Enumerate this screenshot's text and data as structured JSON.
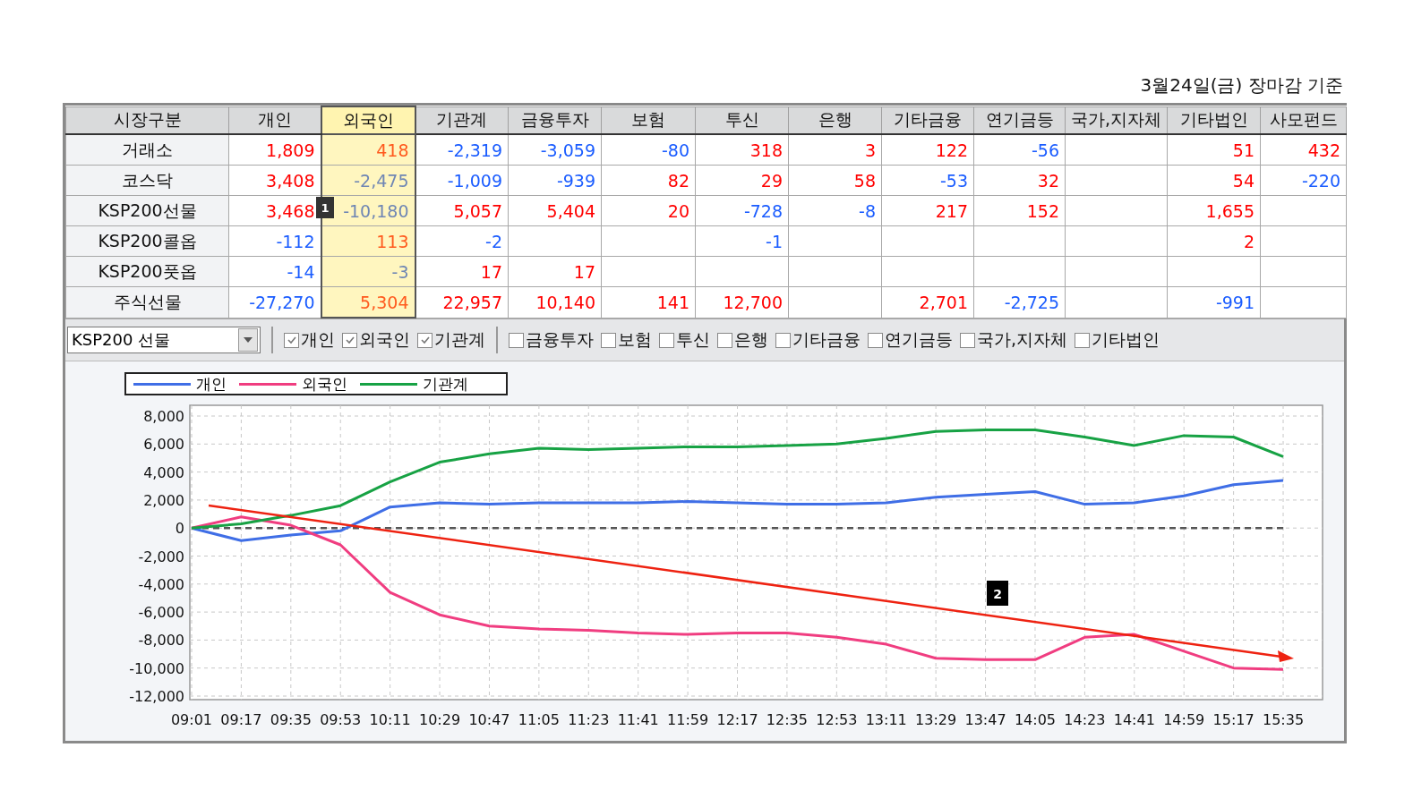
{
  "caption": "3월24일(금) 장마감 기준",
  "table": {
    "marker": "1",
    "columns": [
      {
        "label": "시장구분",
        "highlighted": false
      },
      {
        "label": "개인",
        "highlighted": false
      },
      {
        "label": "외국인",
        "highlighted": true
      },
      {
        "label": "기관계",
        "highlighted": false
      },
      {
        "label": "금융투자",
        "highlighted": false
      },
      {
        "label": "보험",
        "highlighted": false
      },
      {
        "label": "투신",
        "highlighted": false
      },
      {
        "label": "은행",
        "highlighted": false
      },
      {
        "label": "기타금융",
        "highlighted": false
      },
      {
        "label": "연기금등",
        "highlighted": false
      },
      {
        "label": "국가,지자체",
        "highlighted": false
      },
      {
        "label": "기타법인",
        "highlighted": false
      },
      {
        "label": "사모펀드",
        "highlighted": false
      }
    ],
    "rows": [
      {
        "cells": [
          {
            "text": "거래소"
          },
          {
            "text": "1,809",
            "color": "#ff0000"
          },
          {
            "text": "418",
            "color": "#ff5a1e"
          },
          {
            "text": "-2,319",
            "color": "#1a5cff"
          },
          {
            "text": "-3,059",
            "color": "#1a5cff"
          },
          {
            "text": "-80",
            "color": "#1a5cff"
          },
          {
            "text": "318",
            "color": "#ff0000"
          },
          {
            "text": "3",
            "color": "#ff0000"
          },
          {
            "text": "122",
            "color": "#ff0000"
          },
          {
            "text": "-56",
            "color": "#1a5cff"
          },
          null,
          {
            "text": "51",
            "color": "#ff0000"
          },
          {
            "text": "432",
            "color": "#ff0000"
          }
        ]
      },
      {
        "cells": [
          {
            "text": "코스닥"
          },
          {
            "text": "3,408",
            "color": "#ff0000"
          },
          {
            "text": "-2,475",
            "color": "#6f86b4"
          },
          {
            "text": "-1,009",
            "color": "#1a5cff"
          },
          {
            "text": "-939",
            "color": "#1a5cff"
          },
          {
            "text": "82",
            "color": "#ff0000"
          },
          {
            "text": "29",
            "color": "#ff0000"
          },
          {
            "text": "58",
            "color": "#ff0000"
          },
          {
            "text": "-53",
            "color": "#1a5cff"
          },
          {
            "text": "32",
            "color": "#ff0000"
          },
          null,
          {
            "text": "54",
            "color": "#ff0000"
          },
          {
            "text": "-220",
            "color": "#1a5cff"
          }
        ]
      },
      {
        "cells": [
          {
            "text": "KSP200선물"
          },
          {
            "text": "3,468",
            "color": "#ff0000"
          },
          {
            "text": "-10,180",
            "color": "#6f86b4"
          },
          {
            "text": "5,057",
            "color": "#ff0000"
          },
          {
            "text": "5,404",
            "color": "#ff0000"
          },
          {
            "text": "20",
            "color": "#ff0000"
          },
          {
            "text": "-728",
            "color": "#1a5cff"
          },
          {
            "text": "-8",
            "color": "#1a5cff"
          },
          {
            "text": "217",
            "color": "#ff0000"
          },
          {
            "text": "152",
            "color": "#ff0000"
          },
          null,
          {
            "text": "1,655",
            "color": "#ff0000"
          },
          null
        ]
      },
      {
        "cells": [
          {
            "text": "KSP200콜옵"
          },
          {
            "text": "-112",
            "color": "#1a5cff"
          },
          {
            "text": "113",
            "color": "#ff5a1e"
          },
          {
            "text": "-2",
            "color": "#1a5cff"
          },
          null,
          null,
          {
            "text": "-1",
            "color": "#1a5cff"
          },
          null,
          null,
          null,
          null,
          {
            "text": "2",
            "color": "#ff0000"
          },
          null
        ]
      },
      {
        "cells": [
          {
            "text": "KSP200풋옵"
          },
          {
            "text": "-14",
            "color": "#1a5cff"
          },
          {
            "text": "-3",
            "color": "#6f86b4"
          },
          {
            "text": "17",
            "color": "#ff0000"
          },
          {
            "text": "17",
            "color": "#ff0000"
          },
          null,
          null,
          null,
          null,
          null,
          null,
          null,
          null
        ]
      },
      {
        "cells": [
          {
            "text": "주식선물"
          },
          {
            "text": "-27,270",
            "color": "#1a5cff"
          },
          {
            "text": "5,304",
            "color": "#ff5a1e"
          },
          {
            "text": "22,957",
            "color": "#ff0000"
          },
          {
            "text": "10,140",
            "color": "#ff0000"
          },
          {
            "text": "141",
            "color": "#ff0000"
          },
          {
            "text": "12,700",
            "color": "#ff0000"
          },
          null,
          {
            "text": "2,701",
            "color": "#ff0000"
          },
          {
            "text": "-2,725",
            "color": "#1a5cff"
          },
          null,
          {
            "text": "-991",
            "color": "#1a5cff"
          },
          null
        ]
      }
    ]
  },
  "controls": {
    "dropdown": {
      "value": "KSP200 선물"
    },
    "checkboxes": [
      {
        "label": "개인",
        "checked": true
      },
      {
        "label": "외국인",
        "checked": true
      },
      {
        "label": "기관계",
        "checked": true
      },
      {
        "label": "금융투자",
        "checked": false
      },
      {
        "label": "보험",
        "checked": false
      },
      {
        "label": "투신",
        "checked": false
      },
      {
        "label": "은행",
        "checked": false
      },
      {
        "label": "기타금융",
        "checked": false
      },
      {
        "label": "연기금등",
        "checked": false
      },
      {
        "label": "국가,지자체",
        "checked": false
      },
      {
        "label": "기타법인",
        "checked": false
      }
    ]
  },
  "chart": {
    "chart_data": {
      "type": "line",
      "x": [
        "09:01",
        "09:17",
        "09:35",
        "09:53",
        "10:11",
        "10:29",
        "10:47",
        "11:05",
        "11:23",
        "11:41",
        "11:59",
        "12:17",
        "12:35",
        "12:53",
        "13:11",
        "13:29",
        "13:47",
        "14:05",
        "14:23",
        "14:41",
        "14:59",
        "15:17",
        "15:35"
      ],
      "series": [
        {
          "name": "개인",
          "color": "#3f6ee6",
          "values": [
            0,
            -900,
            -500,
            -200,
            1500,
            1800,
            1700,
            1800,
            1800,
            1800,
            1900,
            1800,
            1700,
            1700,
            1800,
            2200,
            2400,
            2600,
            1700,
            1800,
            2300,
            3100,
            3400
          ]
        },
        {
          "name": "외국인",
          "color": "#f03d80",
          "values": [
            0,
            800,
            200,
            -1200,
            -4600,
            -6200,
            -7000,
            -7200,
            -7300,
            -7500,
            -7600,
            -7500,
            -7500,
            -7800,
            -8300,
            -9300,
            -9400,
            -9400,
            -7800,
            -7600,
            -8800,
            -10000,
            -10100
          ]
        },
        {
          "name": "기관계",
          "color": "#17a244",
          "values": [
            0,
            300,
            900,
            1600,
            3300,
            4700,
            5300,
            5700,
            5600,
            5700,
            5800,
            5800,
            5900,
            6000,
            6400,
            6900,
            7000,
            7000,
            6500,
            5900,
            6600,
            6500,
            5100
          ]
        }
      ],
      "ylim": [
        -12000,
        8000
      ],
      "yticks": [
        {
          "value": 8000,
          "label": "8,000"
        },
        {
          "value": 6000,
          "label": "6,000"
        },
        {
          "value": 4000,
          "label": "4,000"
        },
        {
          "value": 2000,
          "label": "2,000"
        },
        {
          "value": 0,
          "label": "0"
        },
        {
          "value": -2000,
          "label": "-2,000"
        },
        {
          "value": -4000,
          "label": "-4,000"
        },
        {
          "value": -6000,
          "label": "-6,000"
        },
        {
          "value": -8000,
          "label": "-8,000"
        },
        {
          "value": -10000,
          "label": "-10,000"
        },
        {
          "value": -12000,
          "label": "-12,000"
        }
      ],
      "grid": true,
      "ref_lines": [
        {
          "axis": "y",
          "value": 0,
          "color": "#555555"
        }
      ]
    },
    "overlays": [
      {
        "kind": "trend-arrow"
      },
      {
        "kind": "badge",
        "text": "2"
      }
    ]
  }
}
